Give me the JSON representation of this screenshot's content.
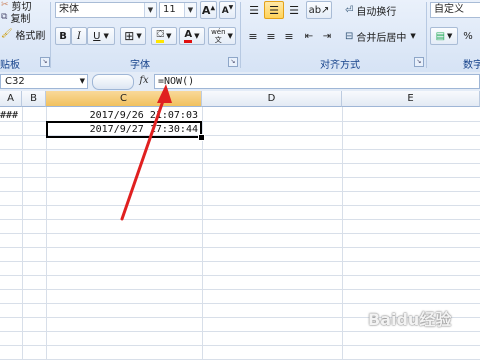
{
  "ribbon": {
    "clipboard": {
      "cut_label": "剪切",
      "copy_label": "复制",
      "format_painter_label": "格式刷",
      "group_label": "贴板"
    },
    "font": {
      "name": "宋体",
      "size": "11",
      "bold": "B",
      "italic": "I",
      "underline": "U",
      "font_color_glyph": "A",
      "phonetic_glyph": "wén",
      "group_label": "字体"
    },
    "alignment": {
      "wrap_label": "自动换行",
      "merge_label": "合并后居中",
      "group_label": "对齐方式"
    },
    "number": {
      "format": "自定义",
      "percent": "%",
      "group_label": "数字"
    }
  },
  "formula_bar": {
    "name_box": "C32",
    "fx": "fx",
    "formula": "=NOW()"
  },
  "grid": {
    "columns": [
      "A",
      "B",
      "C",
      "D",
      "E"
    ],
    "selected_column": "C",
    "cells": [
      {
        "col": "A",
        "value": "###"
      },
      {
        "col": "C",
        "value": "2017/9/26 21:07:03"
      },
      {
        "col": "C",
        "value": "2017/9/27 17:30:44"
      }
    ]
  },
  "watermark": "Baidu经验",
  "annotation_color": "#e02020"
}
